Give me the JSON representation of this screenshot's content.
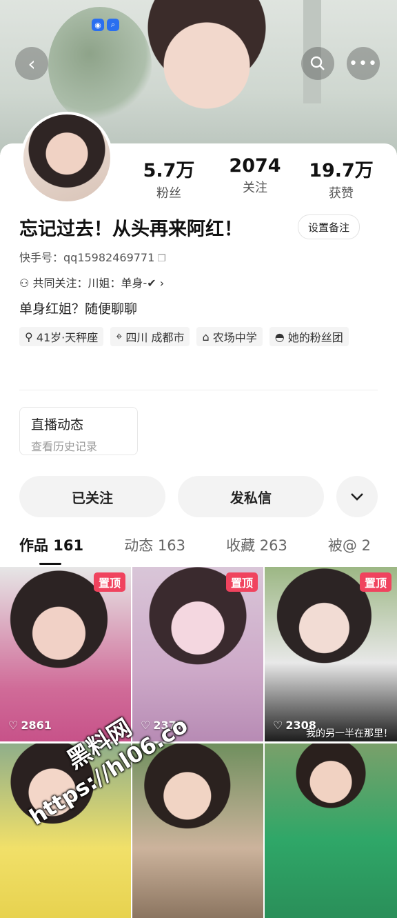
{
  "header": {
    "back_icon": "chevron-left-icon",
    "search_icon": "search-icon",
    "more_icon": "ellipsis-icon"
  },
  "profile": {
    "stats": [
      {
        "value": "5.7万",
        "label": "粉丝"
      },
      {
        "value": "2074",
        "label": "关注"
      },
      {
        "value": "19.7万",
        "label": "获赞"
      }
    ],
    "name": "忘记过去！从头再来阿红！",
    "remark_button": "设置备注",
    "kuaishou_id": "快手号：qq15982469771",
    "mutual_follow": "共同关注：川姐：单身-✔",
    "bio": "单身红姐？随便聊聊",
    "tags": [
      "41岁·天秤座",
      "四川 成都市",
      "农场中学",
      "她的粉丝团"
    ],
    "tag_icons": [
      "female-icon",
      "location-pin-icon",
      "graduation-cap-icon",
      "mask-icon"
    ]
  },
  "live": {
    "title": "直播动态",
    "subtitle": "查看历史记录"
  },
  "actions": {
    "follow": "已关注",
    "message": "发私信",
    "more_icon": "chevron-down-icon"
  },
  "tabs": [
    {
      "label": "作品 161",
      "active": true
    },
    {
      "label": "动态 163",
      "active": false
    },
    {
      "label": "收藏 263",
      "active": false
    },
    {
      "label": "被@ 2",
      "active": false
    }
  ],
  "videos": [
    {
      "pinned": "置顶",
      "likes": "2861"
    },
    {
      "pinned": "置顶",
      "likes": "2377"
    },
    {
      "pinned": "置顶",
      "likes": "2308",
      "caption": "我的另一半在那里！"
    },
    {},
    {},
    {}
  ],
  "watermark": {
    "line1": "黑料网",
    "line2": "https://hl06.co"
  }
}
